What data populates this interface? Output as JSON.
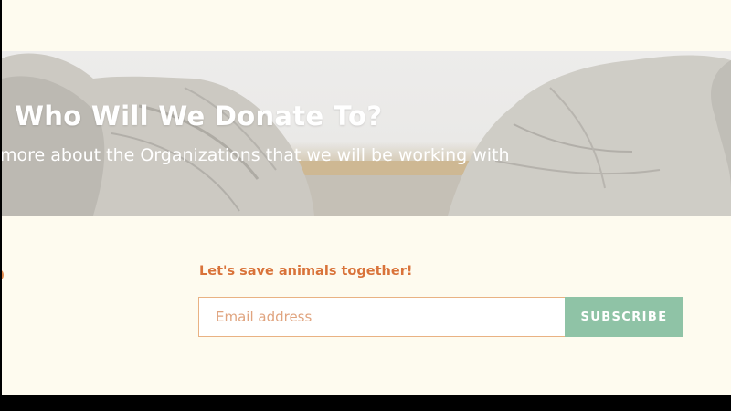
{
  "hero": {
    "title": "Who Will We Donate To?",
    "subtitle": "more about the Organizations that we will be working with",
    "image_subject": "elephants-in-savanna"
  },
  "newsletter": {
    "heading": "Let's save animals together!",
    "email_placeholder": "Email address",
    "subscribe_label": "SUBSCRIBE"
  },
  "colors": {
    "page_background": "#fefbef",
    "accent_orange": "#d9733a",
    "input_border": "#e9b283",
    "subscribe_green": "#8fc3a6",
    "letterbox": "#000000"
  }
}
